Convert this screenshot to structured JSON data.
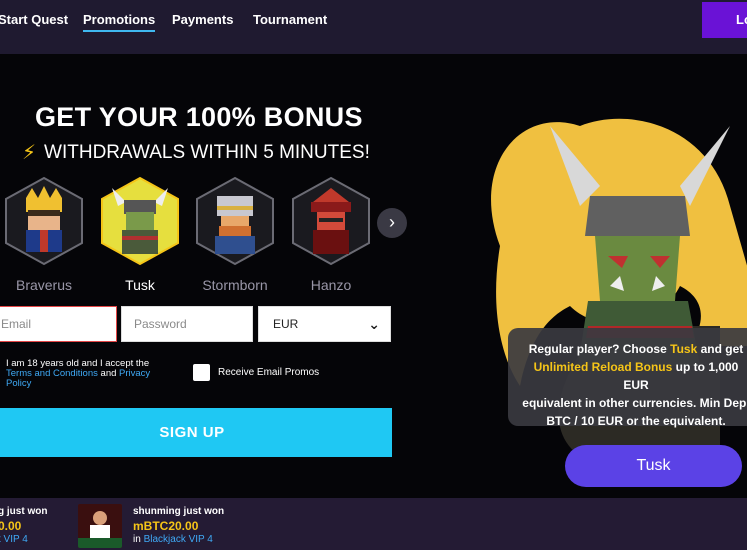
{
  "nav": {
    "items": [
      "Start Quest",
      "Promotions",
      "Payments",
      "Tournament"
    ],
    "login": "Lo"
  },
  "hero": {
    "headline": "GET YOUR 100% BONUS",
    "subline": "WITHDRAWALS WITHIN 5 MINUTES!",
    "characters": [
      "Braverus",
      "Tusk",
      "Stormborn",
      "Hanzo"
    ],
    "selected_character": "Tusk"
  },
  "form": {
    "email_placeholder": "Email",
    "password_placeholder": "Password",
    "currency": "EUR",
    "terms_prefix": "I am 18 years old and I accept the",
    "terms_link": "Terms and Conditions",
    "terms_and": "and",
    "privacy_link": "Privacy Policy",
    "email_promos": "Receive Email Promos",
    "signup": "SIGN UP"
  },
  "promo": {
    "line1_a": "Regular player? Choose",
    "line1_tusk": "Tusk",
    "line1_b": "and get",
    "line2_bonus": "Unlimited Reload Bonus",
    "line2_b": "up to 1,000 EUR",
    "line3": "equivalent in other currencies. Min Dep.",
    "line4": "BTC / 10 EUR or the equivalent.",
    "button": "Tusk"
  },
  "winners": [
    {
      "name": "g just won",
      "amount": "0.00",
      "in": "t VIP 4"
    },
    {
      "name": "shunming just won",
      "amount": "mBTC20.00",
      "in_prefix": "in",
      "game": "Blackjack VIP 4"
    }
  ],
  "colors": {
    "accent": "#1fc8f3",
    "nav_bg": "#1f1a30",
    "gold": "#f5c518",
    "purple": "#5b42e6"
  }
}
